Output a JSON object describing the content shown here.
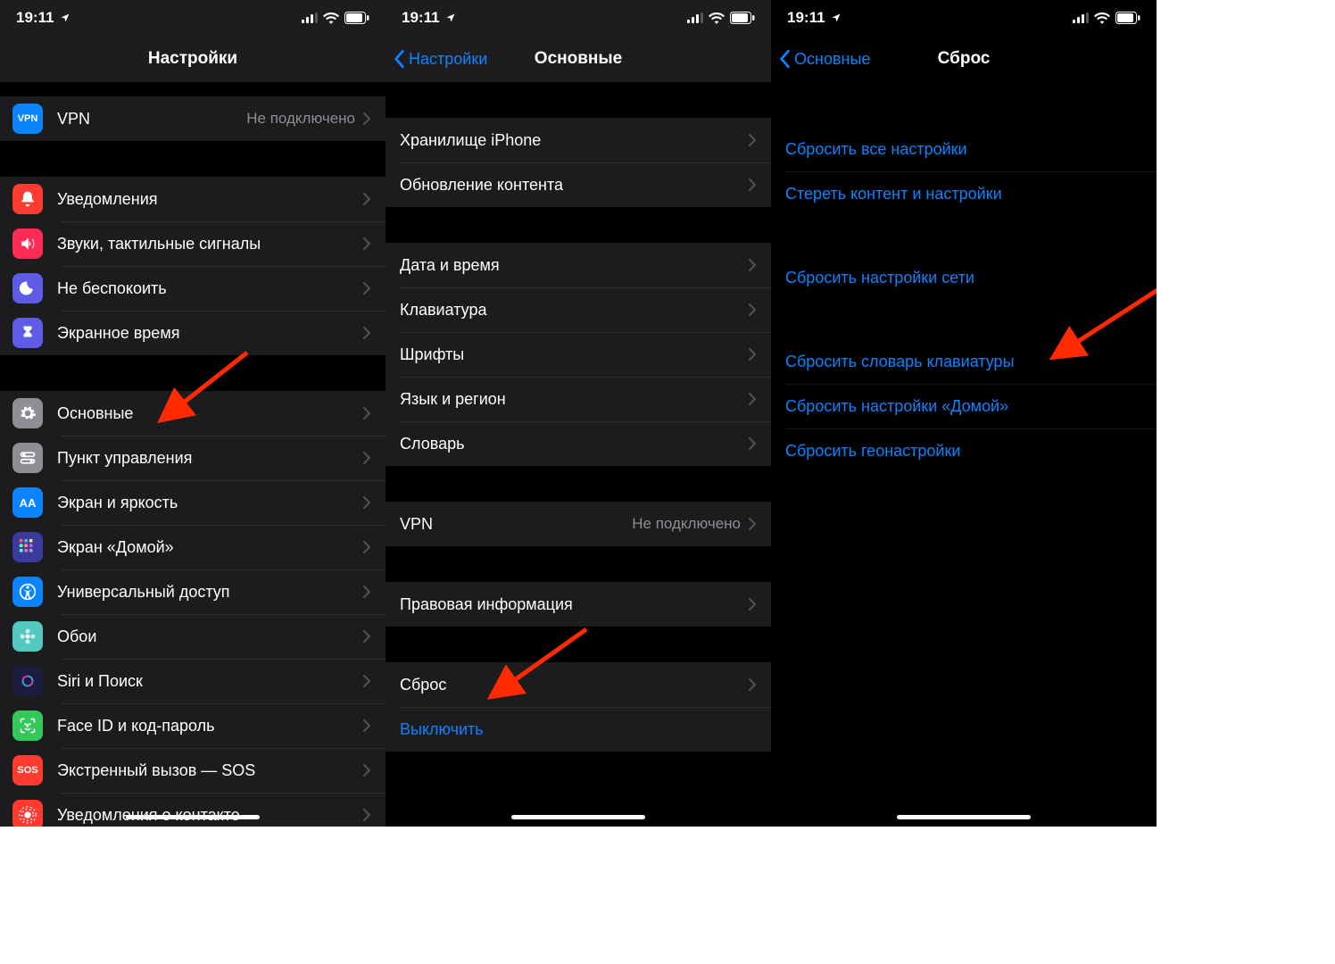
{
  "statusbar": {
    "time": "19:11"
  },
  "screen1": {
    "title": "Настройки",
    "group1": [
      {
        "icon": "vpn",
        "label": "VPN",
        "detail": "Не подключено",
        "bg": "#0a84ff",
        "fg": "#fff",
        "glyph": "VPN"
      }
    ],
    "group2": [
      {
        "icon": "bell",
        "label": "Уведомления",
        "bg": "#ff3b30"
      },
      {
        "icon": "speaker",
        "label": "Звуки, тактильные сигналы",
        "bg": "#ff2d55"
      },
      {
        "icon": "moon",
        "label": "Не беспокоить",
        "bg": "#5e5ce6"
      },
      {
        "icon": "hourglass",
        "label": "Экранное время",
        "bg": "#5e5ce6"
      }
    ],
    "group3": [
      {
        "icon": "gear",
        "label": "Основные",
        "bg": "#8e8e93"
      },
      {
        "icon": "switches",
        "label": "Пункт управления",
        "bg": "#8e8e93"
      },
      {
        "icon": "aa",
        "label": "Экран и яркость",
        "bg": "#0a84ff",
        "glyph": "AA"
      },
      {
        "icon": "grid",
        "label": "Экран «Домой»",
        "bg": "#3a3a9f"
      },
      {
        "icon": "accessibility",
        "label": "Универсальный доступ",
        "bg": "#0a84ff"
      },
      {
        "icon": "flower",
        "label": "Обои",
        "bg": "#54c7c0"
      },
      {
        "icon": "siri",
        "label": "Siri и Поиск",
        "bg": "#1c1c3e"
      },
      {
        "icon": "faceid",
        "label": "Face ID и код-пароль",
        "bg": "#34c759"
      },
      {
        "icon": "sos",
        "label": "Экстренный вызов — SOS",
        "bg": "#ff3b30",
        "glyph": "SOS"
      },
      {
        "icon": "exposure",
        "label": "Уведомления о контакте",
        "bg": "#ff3b30"
      }
    ]
  },
  "screen2": {
    "back": "Настройки",
    "title": "Основные",
    "group1": [
      {
        "label": "Хранилище iPhone"
      },
      {
        "label": "Обновление контента"
      }
    ],
    "group2": [
      {
        "label": "Дата и время"
      },
      {
        "label": "Клавиатура"
      },
      {
        "label": "Шрифты"
      },
      {
        "label": "Язык и регион"
      },
      {
        "label": "Словарь"
      }
    ],
    "group3": [
      {
        "label": "VPN",
        "detail": "Не подключено"
      }
    ],
    "group4": [
      {
        "label": "Правовая информация"
      }
    ],
    "group5": [
      {
        "label": "Сброс"
      },
      {
        "label": "Выключить",
        "link": true,
        "nochev": true
      }
    ]
  },
  "screen3": {
    "back": "Основные",
    "title": "Сброс",
    "group1": [
      {
        "label": "Сбросить все настройки",
        "link": true,
        "plain": true
      },
      {
        "label": "Стереть контент и настройки",
        "link": true,
        "plain": true
      }
    ],
    "group2": [
      {
        "label": "Сбросить настройки сети",
        "link": true,
        "plain": true
      }
    ],
    "group3": [
      {
        "label": "Сбросить словарь клавиатуры",
        "link": true,
        "plain": true
      },
      {
        "label": "Сбросить настройки «Домой»",
        "link": true,
        "plain": true
      },
      {
        "label": "Сбросить геонастройки",
        "link": true,
        "plain": true
      }
    ]
  }
}
